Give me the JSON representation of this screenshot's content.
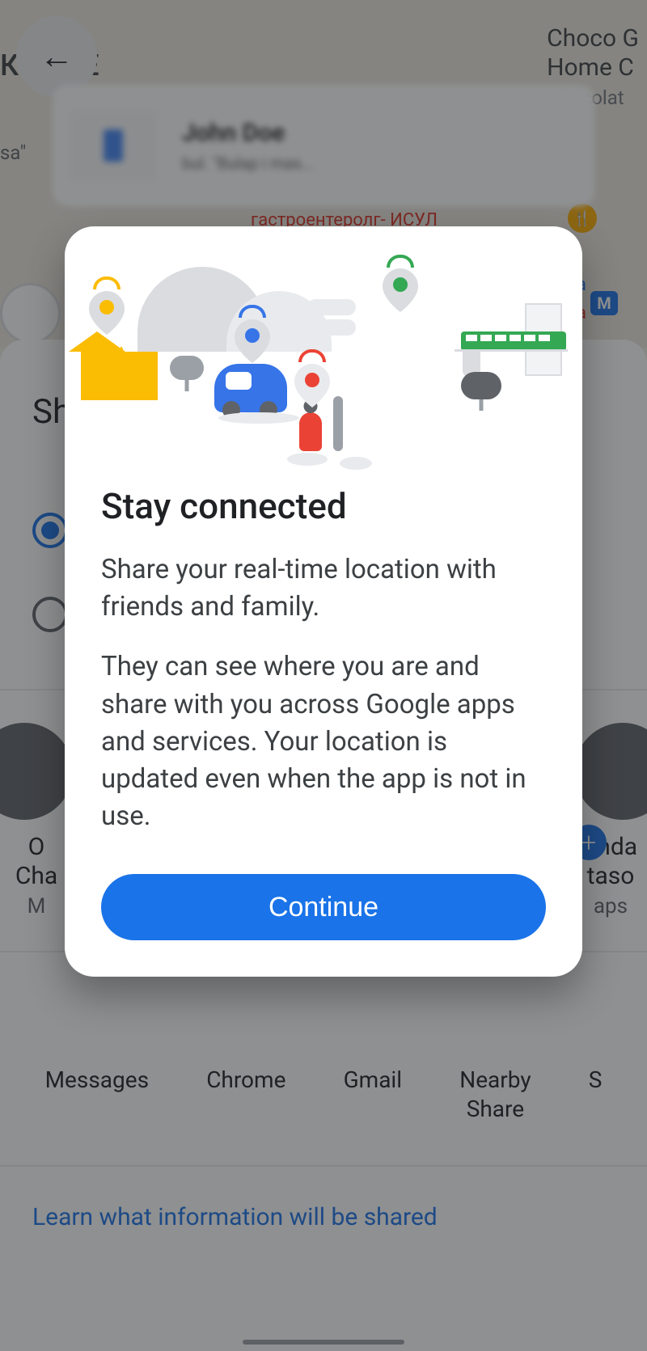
{
  "map": {
    "poi_title": "Choco G",
    "poi_line2": "Home C",
    "poi_sub": "Chocolat",
    "text_left": "КК      ИТЕ",
    "text_sa": "sa\"",
    "red_text": "гастроентеролг- ИСУЛ",
    "na": "на",
    "ha": "на",
    "metro": "М"
  },
  "topCard": {
    "name": "John Doe",
    "sub": "bul. \"Bulap i mas..."
  },
  "sheet": {
    "title": "Sh"
  },
  "contacts": [
    {
      "name": "O",
      "name2": "Cha",
      "sub": "M"
    },
    {
      "name": "anda",
      "name2": "taso",
      "sub": "aps"
    }
  ],
  "shareApps": [
    {
      "label": "Messages"
    },
    {
      "label": "Chrome"
    },
    {
      "label": "Gmail"
    },
    {
      "label": "Nearby\nShare"
    },
    {
      "label": "S"
    }
  ],
  "learnMore": "Learn what information will be shared",
  "dialog": {
    "title": "Stay connected",
    "para1": "Share your real-time location with friends and family.",
    "para2": "They can see where you are and share with you across Google apps and services. Your location is updated even when the app is not in use.",
    "button": "Continue"
  }
}
